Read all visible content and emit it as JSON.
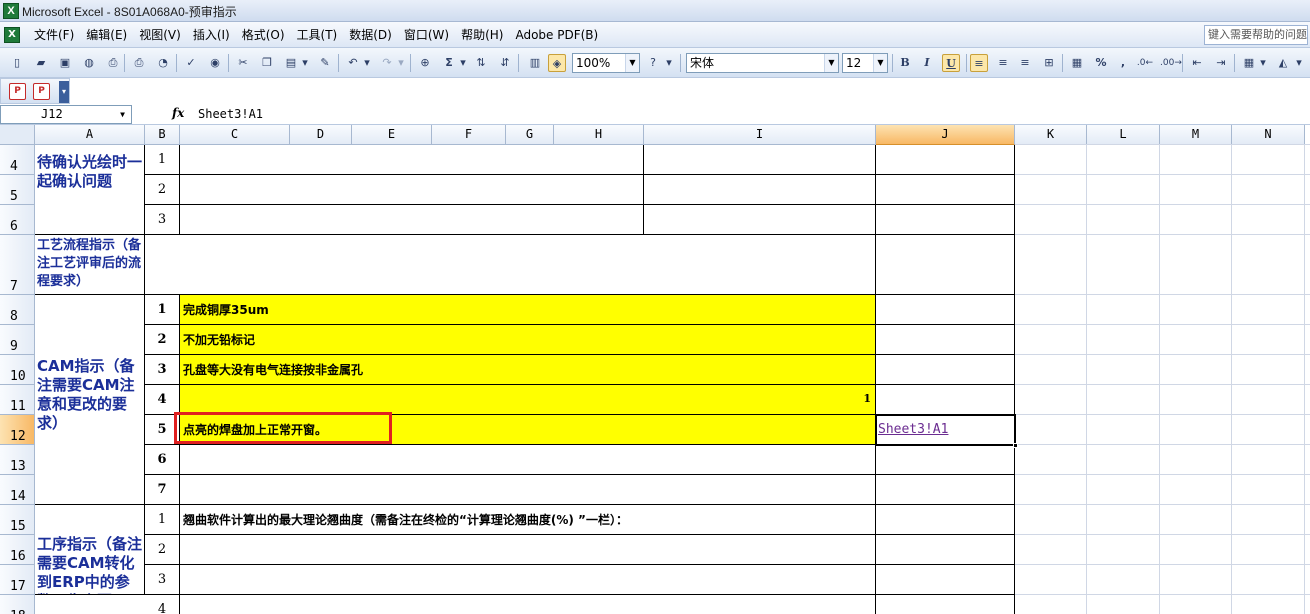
{
  "window": {
    "title": "Microsoft Excel - 8S01A068A0-预审指示",
    "app_icon": "excel-app-icon"
  },
  "menu": {
    "items": [
      "文件(F)",
      "编辑(E)",
      "视图(V)",
      "插入(I)",
      "格式(O)",
      "工具(T)",
      "数据(D)",
      "窗口(W)",
      "帮助(H)",
      "Adobe PDF(B)"
    ],
    "help_placeholder": "键入需要帮助的问题"
  },
  "toolbar": {
    "zoom": "100%",
    "font_name": "宋体",
    "font_size": "12",
    "bold": "B",
    "italic": "I",
    "underline": "U",
    "percent": "%",
    "comma": ","
  },
  "formula_bar": {
    "name_box": "J12",
    "fx": "fx",
    "formula": "Sheet3!A1"
  },
  "columns": [
    "A",
    "B",
    "C",
    "D",
    "E",
    "F",
    "G",
    "H",
    "I",
    "J",
    "K",
    "L",
    "M",
    "N"
  ],
  "selected_column": "J",
  "rows": [
    "4",
    "5",
    "6",
    "7",
    "8",
    "9",
    "10",
    "11",
    "12",
    "13",
    "14",
    "15",
    "16",
    "17",
    "18"
  ],
  "selected_row": "12",
  "cells": {
    "a4": "待确认光绘时一起确认问题",
    "a7": "工艺流程指示（备注工艺评审后的流程要求）",
    "a8": "CAM指示（备注需要CAM注意和更改的要求）",
    "a15": "工序指示（备注需要CAM转化到ERP中的参数、生产要",
    "b": [
      "1",
      "2",
      "3",
      "1",
      "2",
      "3",
      "4",
      "5",
      "6",
      "7",
      "1",
      "2",
      "3",
      "4"
    ],
    "c8": "完成铜厚35um",
    "c9": "不加无铅标记",
    "c10": "孔盘等大没有电气连接按非金属孔",
    "c11_num": "1",
    "c12": "点亮的焊盘加上正常开窗。",
    "c15": "翘曲软件计算出的最大理论翘曲度（需备注在终检的“计算理论翘曲度(%) ”一栏）：",
    "j12": "Sheet3!A1"
  },
  "colors": {
    "highlight": "#ffff00",
    "label_blue": "#1b2f99",
    "annotation_red": "#e02020"
  }
}
